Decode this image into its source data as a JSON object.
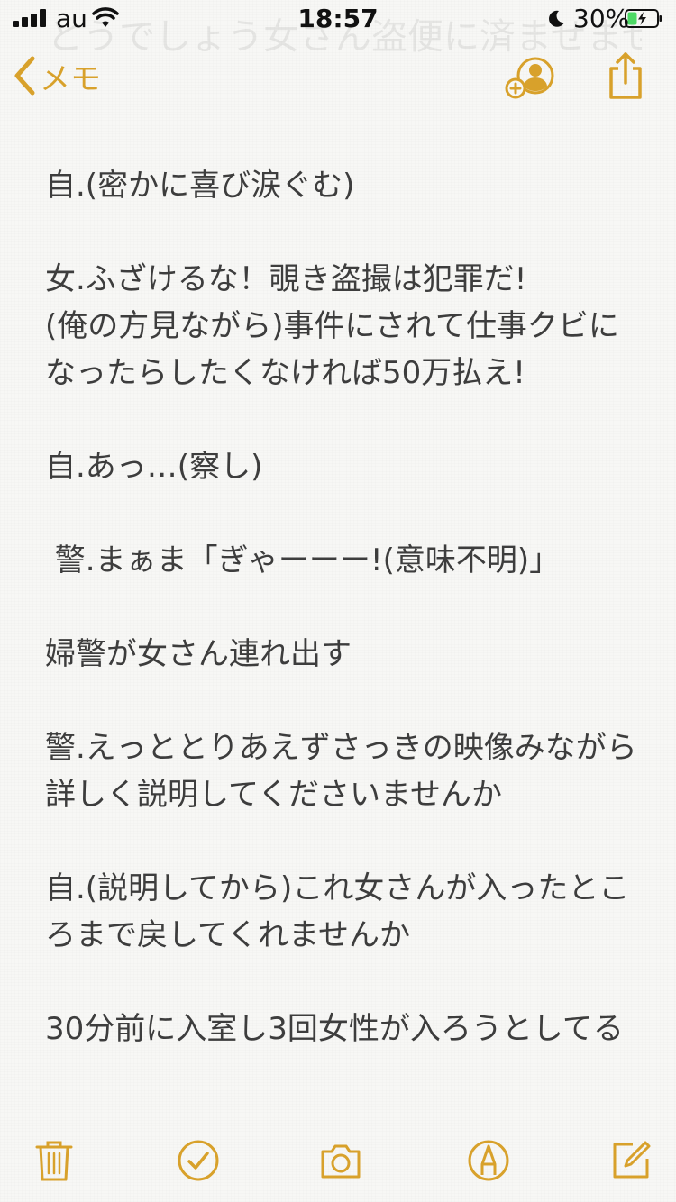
{
  "status_bar": {
    "carrier": "au",
    "time": "18:57",
    "battery": "30%"
  },
  "nav": {
    "back_label": "メモ"
  },
  "ghost_text": "とうでしょう女さん盗便に済ませません",
  "note": {
    "paragraphs": [
      "自.(密かに喜び涙ぐむ)",
      "女.ふざけるな！覗き盗撮は犯罪だ!\n(俺の方見ながら)事件にされて仕事クビになったらしたくなければ50万払え!",
      "自.あっ…(察し)",
      " 警.まぁま「ぎゃーーー!(意味不明)」",
      "婦警が女さん連れ出す",
      "警.えっととりあえずさっきの映像みながら詳しく説明してくださいませんか",
      "自.(説明してから)これ女さんが入ったところまで戻してくれませんか",
      "30分前に入室し3回女性が入ろうとしてる"
    ]
  },
  "colors": {
    "accent": "#d8a12b",
    "background": "#f7f7f5",
    "text": "#3d3d3d"
  },
  "icons": {
    "back": "chevron-left-icon",
    "add_person": "add-person-icon",
    "share": "share-icon",
    "trash": "trash-icon",
    "checklist": "checkmark-circle-icon",
    "camera": "camera-icon",
    "markup": "pen-circle-icon",
    "compose": "compose-icon"
  }
}
